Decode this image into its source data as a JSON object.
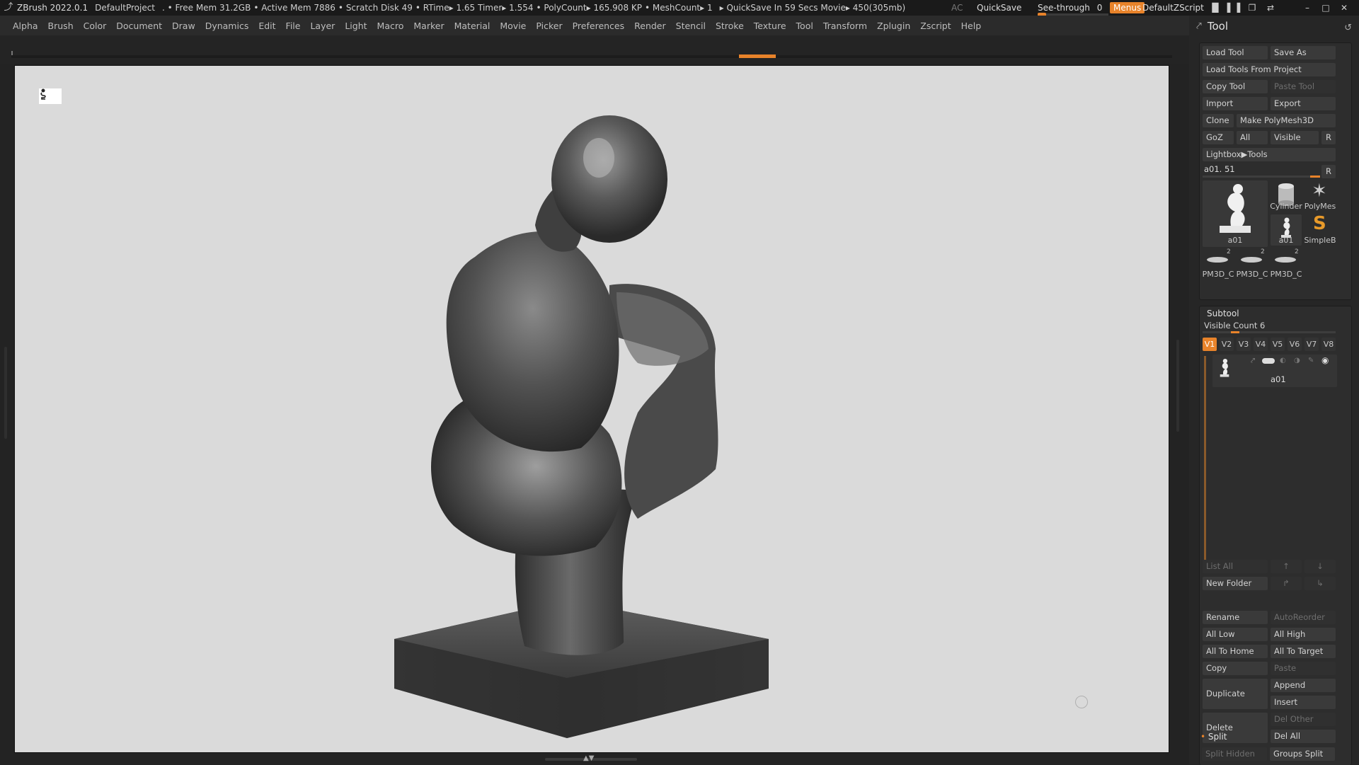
{
  "titlebar": {
    "app": "ZBrush 2022.0.1",
    "project": "DefaultProject",
    "free_mem": ". • Free Mem 31.2GB",
    "active_mem": "• Active Mem 7886",
    "scratch": "• Scratch Disk 49",
    "rtime": "• RTime▸ 1.65 Timer▸ 1.554",
    "polycount": "• PolyCount▸ 165.908 KP",
    "meshcount": "• MeshCount▸ 1",
    "quicksave_info": "▸ QuickSave In 59 Secs Movie▸ 450(305mb)",
    "ac": "AC",
    "quicksave": "QuickSave",
    "see_through": "See-through",
    "see_through_value": "0",
    "menus": "Menus",
    "zscript": "DefaultZScript"
  },
  "menubar": [
    "Alpha",
    "Brush",
    "Color",
    "Document",
    "Draw",
    "Dynamics",
    "Edit",
    "File",
    "Layer",
    "Light",
    "Macro",
    "Marker",
    "Material",
    "Movie",
    "Picker",
    "Preferences",
    "Render",
    "Stencil",
    "Stroke",
    "Texture",
    "Tool",
    "Transform",
    "Zplugin",
    "Zscript",
    "Help"
  ],
  "tool_panel": {
    "title": "Tool",
    "load_tool": "Load Tool",
    "save_as": "Save As",
    "load_tools_from_project": "Load Tools From Project",
    "copy_tool": "Copy Tool",
    "paste_tool": "Paste Tool",
    "import": "Import",
    "export": "Export",
    "clone": "Clone",
    "make_polymesh3d": "Make PolyMesh3D",
    "goz": "GoZ",
    "all": "All",
    "visible": "Visible",
    "r": "R",
    "lightbox_tools": "Lightbox▶Tools",
    "current_tool": "a01. 51",
    "thumbs": {
      "a01_big": "a01",
      "cylinder": "Cylinder",
      "polymesh": "PolyMes",
      "a01_small": "a01",
      "simpleb": "SimpleB",
      "pm3d_1": "PM3D_C",
      "pm3d_2": "PM3D_C",
      "pm3d_3": "PM3D_C",
      "pm3d_badge": "2"
    }
  },
  "subtool": {
    "title": "Subtool",
    "visible_count": "Visible Count 6",
    "versions": [
      "V1",
      "V2",
      "V3",
      "V4",
      "V5",
      "V6",
      "V7",
      "V8"
    ],
    "item_name": "a01",
    "list_all": "List All",
    "new_folder": "New Folder",
    "rename": "Rename",
    "auto_reorder": "AutoReorder",
    "all_low": "All Low",
    "all_high": "All High",
    "all_to_home": "All To Home",
    "all_to_target": "All To Target",
    "copy": "Copy",
    "paste": "Paste",
    "duplicate": "Duplicate",
    "append": "Append",
    "insert": "Insert",
    "delete": "Delete",
    "del_other": "Del Other",
    "del_all": "Del All",
    "split": "Split",
    "split_hidden": "Split Hidden",
    "groups_split": "Groups Split"
  }
}
